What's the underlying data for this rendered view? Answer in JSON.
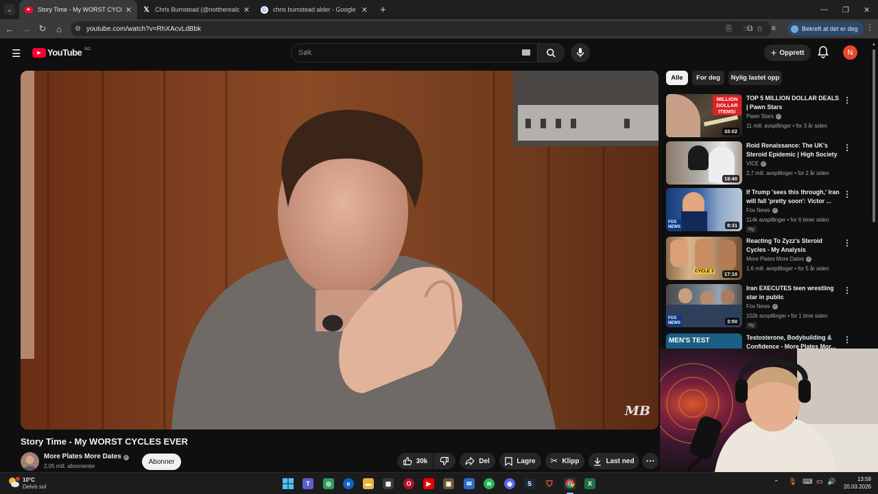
{
  "browser": {
    "tabs": [
      {
        "title": "Story Time - My WORST CYCLE",
        "active": true
      },
      {
        "title": "Chris Bumstead (@nottherealcb",
        "active": false
      },
      {
        "title": "chris bumstead alder - Google",
        "active": false
      }
    ],
    "url": "youtube.com/watch?v=RhXAcvLdBbk",
    "profile_label": "Bekreft at det er deg"
  },
  "youtube": {
    "logo_text": "YouTube",
    "region": "NO",
    "search_placeholder": "Søk",
    "create_label": "Opprett",
    "avatar_letter": "N"
  },
  "video": {
    "title": "Story Time - My WORST CYCLES EVER",
    "channel": "More Plates More Dates",
    "subscribers": "2,05 mill. abonnenter",
    "subscribe_label": "Abonner",
    "likes": "30k",
    "share_label": "Del",
    "save_label": "Lagre",
    "clip_label": "Klipp",
    "download_label": "Last ned",
    "watermark": "MB"
  },
  "filters": [
    "Alle",
    "For deg",
    "Nylig lastet opp"
  ],
  "recommendations": [
    {
      "title": "TOP 5 MILLION DOLLAR DEALS | Pawn Stars",
      "channel": "Pawn Stars",
      "meta": "11 mill. avspillinger • for 3 år siden",
      "duration": "33:02",
      "badge": "",
      "thumb_text": "MILLION DOLLAR ITEMS!"
    },
    {
      "title": "Roid Renaissance: The UK's Steroid Epidemic | High Society",
      "channel": "VICE",
      "meta": "2,7 mill. avspillinger • for 2 år siden",
      "duration": "19:40",
      "badge": "",
      "thumb_text": ""
    },
    {
      "title": "If Trump 'sees this through,' Iran will fall 'pretty soon': Victor ...",
      "channel": "Fox News",
      "meta": "114k avspillinger • for 6 timer siden",
      "duration": "8:31",
      "badge": "Ny",
      "thumb_text": "FOX NEWS"
    },
    {
      "title": "Reacting To Zyzz's Steroid Cycles - My Analysis",
      "channel": "More Plates More Dates",
      "meta": "1,6 mill. avspillinger • for 5 år siden",
      "duration": "17:10",
      "badge": "",
      "thumb_text": "CYCLE 3"
    },
    {
      "title": "Iran EXECUTES teen wrestling star in public",
      "channel": "Fox News",
      "meta": "102k avspillinger • for 1 time siden",
      "duration": "3:50",
      "badge": "Ny",
      "thumb_text": "FOX NEWS"
    },
    {
      "title": "Testosterone, Bodybuilding & Confidence - More Plates Mor...",
      "channel": "",
      "meta": "",
      "duration": "",
      "badge": "",
      "thumb_text": "MEN'S TEST"
    }
  ],
  "taskbar": {
    "weather_temp": "10°C",
    "weather_desc": "Delvis sol",
    "time": "13:59",
    "date": "20.03.2026"
  }
}
